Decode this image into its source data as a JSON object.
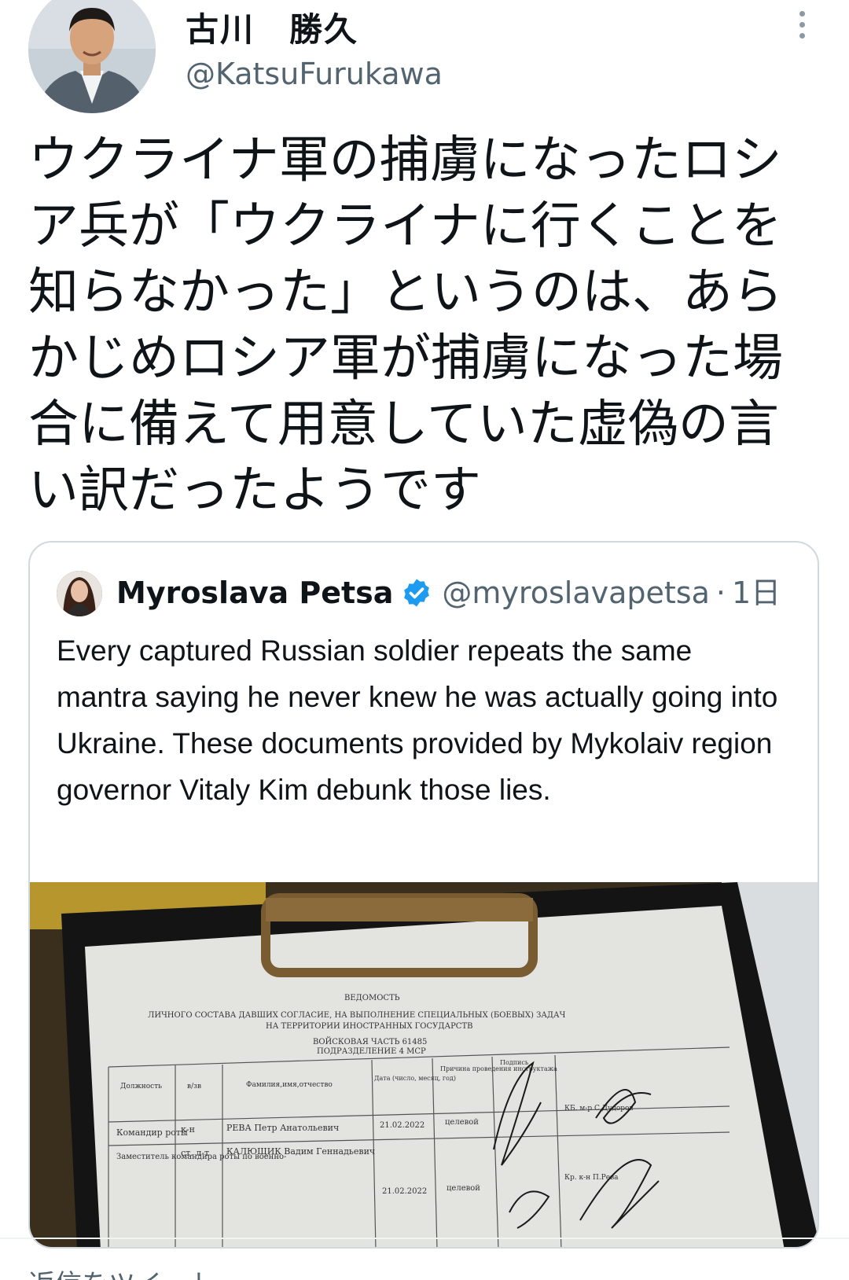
{
  "author": {
    "display_name": "古川　勝久",
    "handle": "@KatsuFurukawa",
    "avatar_icon": "profile-photo"
  },
  "menu": {
    "icon": "more-vertical-icon"
  },
  "tweet": {
    "text": "ウクライナ軍の捕虜になったロシア兵が「ウクライナに行くことを知らなかった」というのは、あらかじめロシア軍が捕虜になった場合に備えて用意していた虚偽の言い訳だったようです"
  },
  "quoted_tweet": {
    "author_name": "Myroslava Petsa",
    "verified_icon": "verified-badge-icon",
    "handle": "@myroslavapetsa",
    "separator": "·",
    "time": "1日",
    "text": "Every captured Russian soldier repeats the same mantra saying he never knew he was actually going into Ukraine. These documents provided by Mykolaiv region governor Vitaly Kim debunk those lies.",
    "photo": {
      "doc_title": "ВЕДОМОСТЬ",
      "doc_line2": "ЛИЧНОГО СОСТАВА ДАВШИХ СОГЛАСИЕ, НА ВЫПОЛНЕНИЕ СПЕЦИАЛЬНЫХ (БОЕВЫХ) ЗАДАЧ",
      "doc_line3": "НА ТЕРРИТОРИИ ИНОСТРАННЫХ ГОСУДАРСТВ",
      "doc_line4": "ВОЙСКОВАЯ ЧАСТЬ 61485",
      "doc_line5": "ПОДРАЗДЕЛЕНИЕ 4 МСР",
      "col_position": "Должность",
      "col_rank": "в/зв",
      "col_name": "Фамилия,имя,отчество",
      "col_date": "Дата (число, месяц, год)",
      "col_reason": "Причина проведения инструктажа",
      "col_sign": "Подпись",
      "row1_position": "Командир роты",
      "row1_rank": "к-н",
      "row1_name": "РЕВА Петр Анатольевич",
      "row1_date": "21.02.2022",
      "row1_reason": "целевой",
      "row1_sign_note": "КБ. м-р С.Дудоров",
      "row2_position": "Заместитель командира роты по военно-",
      "row2_rank": "ст. л-т",
      "row2_name": "КАЛЮЩИК Вадим Геннадьевич",
      "row2_date": "21.02.2022",
      "row2_reason": "целевой",
      "row2_sign_note": "Кр. к-н П.Рева"
    }
  },
  "footer": {
    "label": "返信をツイート"
  }
}
